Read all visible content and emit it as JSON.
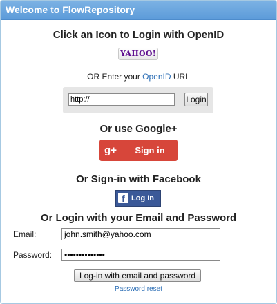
{
  "window": {
    "title": "Welcome to FlowRepository"
  },
  "openid": {
    "heading": "Click an Icon to Login with OpenID",
    "provider_logo_text": "YAHOO!",
    "enter_prefix": "OR Enter your ",
    "enter_link": "OpenID",
    "enter_suffix": " URL",
    "url_value": "http://",
    "login_label": "Login"
  },
  "google": {
    "heading": "Or use Google+",
    "icon_text": "g+",
    "button_label": "Sign in",
    "color": "#d7463a"
  },
  "facebook": {
    "heading": "Or Sign-in with Facebook",
    "icon_text": "f",
    "button_label": "Log In",
    "color": "#3b5998"
  },
  "email_login": {
    "heading": "Or Login with your Email and Password",
    "email_label": "Email:",
    "email_value": "john.smith@yahoo.com",
    "password_label": "Password:",
    "password_value": "••••••••••••••",
    "submit_label": "Log-in with email and password",
    "reset_link": "Password reset"
  }
}
